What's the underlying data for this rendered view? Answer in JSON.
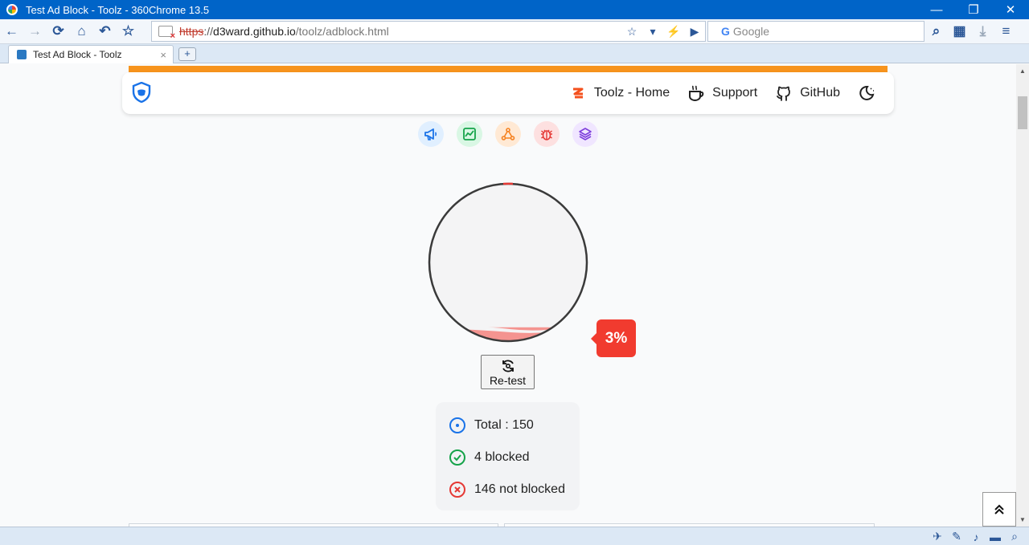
{
  "window": {
    "title": "Test Ad Block - Toolz - 360Chrome 13.5",
    "minimize_glyph": "—",
    "restore_glyph": "❐",
    "close_glyph": "✕"
  },
  "toolbar": {
    "back_glyph": "←",
    "forward_glyph": "→",
    "reload_glyph": "⟳",
    "home_glyph": "⌂",
    "undo_glyph": "↶",
    "bookmark_glyph": "☆",
    "address": {
      "scheme": "https",
      "sep": "://",
      "host": "d3ward.github.io",
      "path": "/toolz/adblock.html"
    },
    "star_glyph": "☆",
    "dropdown_glyph": "▾",
    "flash_glyph": "⚡",
    "play_glyph": "▶",
    "search_placeholder": "Google",
    "search_logo": "G",
    "search_btn_glyph": "⌕",
    "apps_glyph": "▦",
    "download_glyph": "⤓",
    "menu_glyph": "≡"
  },
  "tabs": [
    {
      "label": "Test Ad Block - Toolz",
      "close": "×"
    }
  ],
  "newtab_glyph": "+",
  "nav": {
    "links": [
      {
        "label": "Toolz - Home",
        "icon": "toolz-z-icon"
      },
      {
        "label": "Support",
        "icon": "coffee-icon"
      },
      {
        "label": "GitHub",
        "icon": "github-icon"
      }
    ],
    "theme_icon": "moon-icon"
  },
  "category_icons": [
    {
      "icon": "megaphone-icon",
      "bg": "#e0efff",
      "fg": "#1a73e8"
    },
    {
      "icon": "chart-line-icon",
      "bg": "#d9f7e4",
      "fg": "#16a34a"
    },
    {
      "icon": "analytics-icon",
      "bg": "#ffe9d4",
      "fg": "#f58220"
    },
    {
      "icon": "bug-icon",
      "bg": "#fde0e0",
      "fg": "#e53935"
    },
    {
      "icon": "layers-icon",
      "bg": "#f0e6ff",
      "fg": "#7e3fdc"
    }
  ],
  "result": {
    "percent": 3,
    "percent_label": "3%",
    "retest_label": "Re-test",
    "total_label": "Total : 150",
    "blocked_label": "4 blocked",
    "not_blocked_label": "146 not blocked",
    "colors": {
      "total": "#1a73e8",
      "blocked": "#16a34a",
      "not_blocked": "#e53935",
      "badge": "#f13b2f"
    }
  },
  "totop_glyph": "⌃⌃",
  "statusbar": {
    "icons": [
      "rocket-icon",
      "broom-icon",
      "volume-icon",
      "folder-icon",
      "zoom-icon"
    ],
    "glyphs": [
      "✈",
      "✎",
      "♪",
      "▬",
      "⌕"
    ]
  }
}
